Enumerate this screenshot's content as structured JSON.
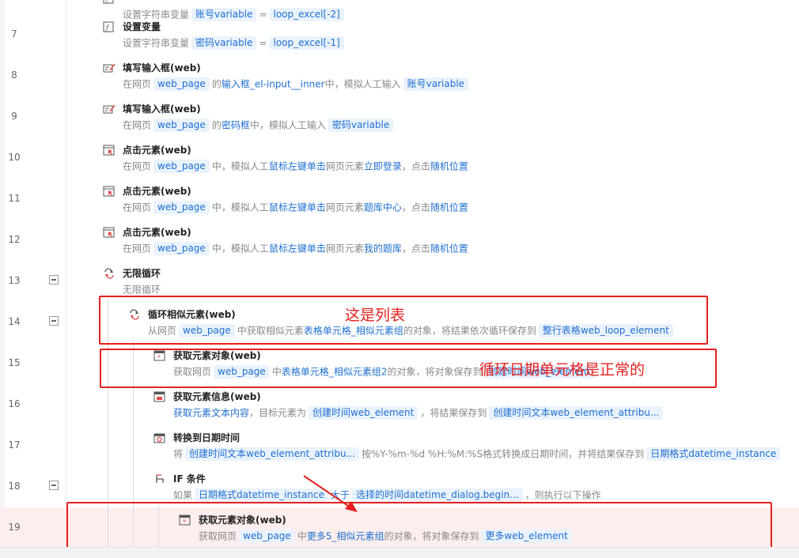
{
  "rows": [
    {
      "num": "",
      "title": "",
      "desc": [
        {
          "t": "text",
          "v": "设置字符串变量"
        },
        {
          "t": "chip",
          "v": "账号variable"
        },
        {
          "t": "text",
          "v": "="
        },
        {
          "t": "chip",
          "v": "loop_excel[-2]"
        }
      ]
    },
    {
      "num": "7",
      "title": "设置变量",
      "desc": [
        {
          "t": "text",
          "v": "设置字符串变量"
        },
        {
          "t": "chip",
          "v": "密码variable"
        },
        {
          "t": "text",
          "v": "="
        },
        {
          "t": "chip",
          "v": "loop_excel[-1]"
        }
      ]
    },
    {
      "num": "8",
      "title": "填写输入框(web)",
      "desc": [
        {
          "t": "text",
          "v": "在网页"
        },
        {
          "t": "chip",
          "v": "web_page"
        },
        {
          "t": "text",
          "v": "的"
        },
        {
          "t": "blue",
          "v": "输入框_el-input__inner"
        },
        {
          "t": "text",
          "v": "中，模拟人工输入"
        },
        {
          "t": "chip",
          "v": "账号variable"
        }
      ]
    },
    {
      "num": "9",
      "title": "填写输入框(web)",
      "desc": [
        {
          "t": "text",
          "v": "在网页"
        },
        {
          "t": "chip",
          "v": "web_page"
        },
        {
          "t": "text",
          "v": "的"
        },
        {
          "t": "blue",
          "v": "密码框"
        },
        {
          "t": "text",
          "v": "中，模拟人工输入"
        },
        {
          "t": "chip",
          "v": "密码variable"
        }
      ]
    },
    {
      "num": "10",
      "title": "点击元素(web)",
      "desc": [
        {
          "t": "text",
          "v": "在网页"
        },
        {
          "t": "chip",
          "v": "web_page"
        },
        {
          "t": "text",
          "v": "中，模拟人工"
        },
        {
          "t": "blue",
          "v": "鼠标左键单击"
        },
        {
          "t": "text",
          "v": "网页元素"
        },
        {
          "t": "blue",
          "v": "立即登录"
        },
        {
          "t": "text",
          "v": "，点击"
        },
        {
          "t": "blue",
          "v": "随机位置"
        }
      ]
    },
    {
      "num": "11",
      "title": "点击元素(web)",
      "desc": [
        {
          "t": "text",
          "v": "在网页"
        },
        {
          "t": "chip",
          "v": "web_page"
        },
        {
          "t": "text",
          "v": "中，模拟人工"
        },
        {
          "t": "blue",
          "v": "鼠标左键单击"
        },
        {
          "t": "text",
          "v": "网页元素"
        },
        {
          "t": "blue",
          "v": "题库中心"
        },
        {
          "t": "text",
          "v": "，点击"
        },
        {
          "t": "blue",
          "v": "随机位置"
        }
      ]
    },
    {
      "num": "12",
      "title": "点击元素(web)",
      "desc": [
        {
          "t": "text",
          "v": "在网页"
        },
        {
          "t": "chip",
          "v": "web_page"
        },
        {
          "t": "text",
          "v": "中，模拟人工"
        },
        {
          "t": "blue",
          "v": "鼠标左键单击"
        },
        {
          "t": "text",
          "v": "网页元素"
        },
        {
          "t": "blue",
          "v": "我的题库"
        },
        {
          "t": "text",
          "v": "，点击"
        },
        {
          "t": "blue",
          "v": "随机位置"
        }
      ]
    },
    {
      "num": "13",
      "title": "无限循环",
      "desc": [
        {
          "t": "text",
          "v": "无限循环"
        }
      ]
    },
    {
      "num": "14",
      "title": "循环相似元素(web)",
      "desc": [
        {
          "t": "text",
          "v": "从网页"
        },
        {
          "t": "chip",
          "v": "web_page"
        },
        {
          "t": "text",
          "v": "中获取相似元素"
        },
        {
          "t": "blue",
          "v": "表格单元格_相似元素组"
        },
        {
          "t": "text",
          "v": "的对象，将结果依次循环保存到"
        },
        {
          "t": "chip",
          "v": "整行表格web_loop_element"
        }
      ]
    },
    {
      "num": "15",
      "title": "获取元素对象(web)",
      "desc": [
        {
          "t": "text",
          "v": "获取网页"
        },
        {
          "t": "chip",
          "v": "web_page"
        },
        {
          "t": "text",
          "v": "中"
        },
        {
          "t": "blue",
          "v": "表格单元格_相似元素组2"
        },
        {
          "t": "text",
          "v": "的对象，将对象保存到"
        },
        {
          "t": "chip",
          "v": "创建时间web_element"
        }
      ]
    },
    {
      "num": "16",
      "title": "获取元素信息(web)",
      "desc": [
        {
          "t": "blue",
          "v": "获取元素文本内容"
        },
        {
          "t": "text",
          "v": "，目标元素为"
        },
        {
          "t": "chip",
          "v": "创建时间web_element"
        },
        {
          "t": "text",
          "v": "，将结果保存到"
        },
        {
          "t": "chip",
          "v": "创建时间文本web_element_attribu..."
        }
      ]
    },
    {
      "num": "17",
      "title": "转换到日期时间",
      "desc": [
        {
          "t": "text",
          "v": "将"
        },
        {
          "t": "chip",
          "v": "创建时间文本web_element_attribu..."
        },
        {
          "t": "text",
          "v": "按%Y-%m-%d %H:%M:%S格式转换成日期时间，并将结果保存到"
        },
        {
          "t": "chip",
          "v": "日期格式datetime_instance"
        }
      ]
    },
    {
      "num": "18",
      "title": "IF 条件",
      "desc": [
        {
          "t": "text",
          "v": "如果"
        },
        {
          "t": "chip",
          "v": "日期格式datetime_instance"
        },
        {
          "t": "blue",
          "v": "大于"
        },
        {
          "t": "chip",
          "v": "选择的时间datetime_dialog.begin..."
        },
        {
          "t": "text",
          "v": "，则执行以下操作"
        }
      ]
    },
    {
      "num": "19",
      "title": "获取元素对象(web)",
      "desc": [
        {
          "t": "text",
          "v": "获取网页"
        },
        {
          "t": "chip",
          "v": "web_page"
        },
        {
          "t": "text",
          "v": "中"
        },
        {
          "t": "blue",
          "v": "更多5_相似元素组"
        },
        {
          "t": "text",
          "v": "的对象，将对象保存到"
        },
        {
          "t": "chip",
          "v": "更多web_element"
        }
      ]
    }
  ],
  "annotations": {
    "list_note": "这是列表",
    "date_note": "循环日期单元格是正常的"
  },
  "colors": {
    "accent": "#1f6fd1",
    "annotation": "#e62020",
    "highlight_row": "#fdeeee"
  }
}
